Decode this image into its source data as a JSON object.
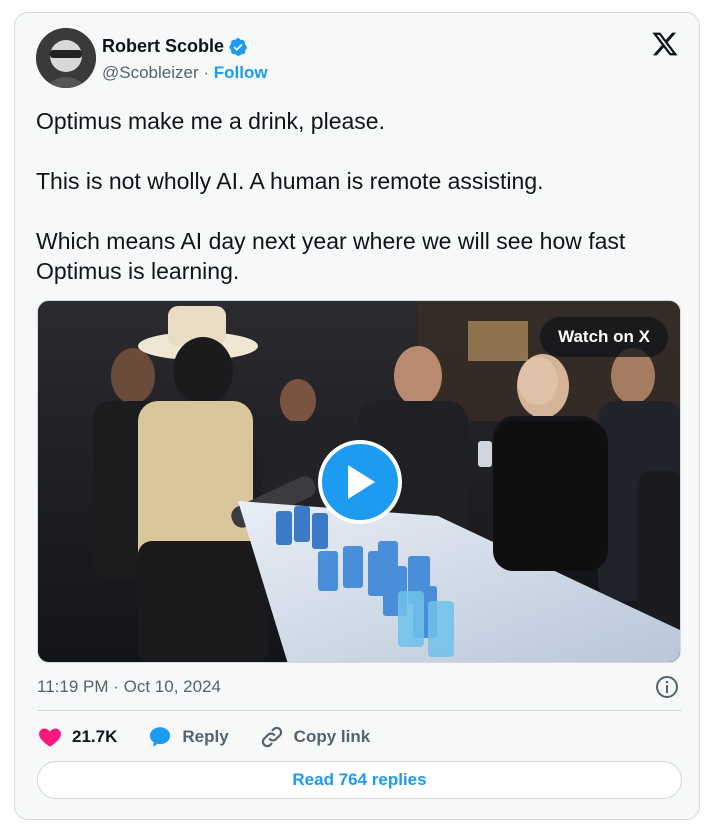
{
  "author": {
    "display_name": "Robert Scoble",
    "handle": "@Scobleizer",
    "separator": "·",
    "follow_label": "Follow"
  },
  "tweet": {
    "paragraphs": [
      "Optimus make me a drink, please.",
      "This is not wholly AI. A human is remote assisting.",
      "Which means AI day next year where we will see how fast Optimus is learning."
    ]
  },
  "media": {
    "watch_label": "Watch on X"
  },
  "meta": {
    "timestamp": "11:19 PM · Oct 10, 2024"
  },
  "actions": {
    "like_count": "21.7K",
    "reply_label": "Reply",
    "copy_label": "Copy link"
  },
  "read_replies_label": "Read 764 replies",
  "colors": {
    "accent": "#1d9bf0",
    "like": "#f91880",
    "text_secondary": "#536471",
    "border": "#cfd9de"
  },
  "icons": [
    "verified-badge-icon",
    "x-logo-icon",
    "play-icon",
    "info-icon",
    "heart-icon",
    "reply-bubble-icon",
    "link-icon"
  ]
}
